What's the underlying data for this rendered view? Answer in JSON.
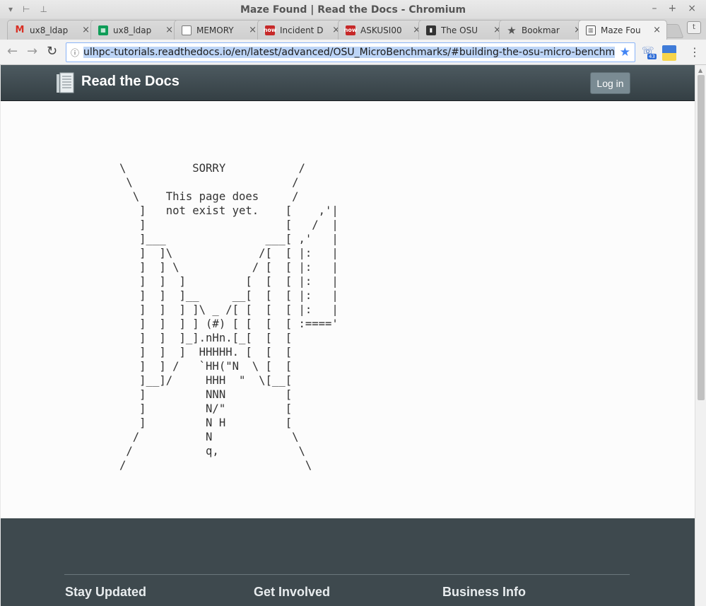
{
  "window": {
    "title": "Maze Found | Read the Docs - Chromium"
  },
  "tabs": [
    {
      "label": "ux8_ldap",
      "icon": "gmail-icon",
      "color": "#d93025"
    },
    {
      "label": "ux8_ldap",
      "icon": "sheets-icon",
      "color": "#0f9d58"
    },
    {
      "label": "MEMORY",
      "icon": "document-icon",
      "color": "#777777"
    },
    {
      "label": "Incident D",
      "icon": "servicenow-icon",
      "color": "#c62828"
    },
    {
      "label": "ASKUSI00",
      "icon": "servicenow-icon",
      "color": "#c62828"
    },
    {
      "label": "The OSU",
      "icon": "book-icon",
      "color": "#333333"
    },
    {
      "label": "Bookmar",
      "icon": "star-icon",
      "color": "#555555"
    },
    {
      "label": "Maze Fou",
      "icon": "readthedocs-icon",
      "color": "#555555",
      "active": true
    }
  ],
  "toolbar": {
    "url": "ulhpc-tutorials.readthedocs.io/en/latest/advanced/OSU_MicroBenchmarks/#building-the-osu-micro-benchmark",
    "extension_badge": "43",
    "ext_t": "t"
  },
  "site": {
    "brand": "Read the Docs",
    "login_label": "Log in"
  },
  "ascii_art": "\\          SORRY           /\n \\                        /\n  \\    This page does     /\n   ]   not exist yet.    [    ,'|\n   ]                     [   /  |\n   ]___               ___[ ,'   |\n   ]  ]\\             /[  [ |:   |\n   ]  ] \\           / [  [ |:   |\n   ]  ]  ]         [  [  [ |:   |\n   ]  ]  ]__     __[  [  [ |:   |\n   ]  ]  ] ]\\ _ /[ [  [  [ |:   |\n   ]  ]  ] ] (#) [ [  [  [ :===='\n   ]  ]  ]_].nHn.[_[  [  [\n   ]  ]  ]  HHHHH. [  [  [\n   ]  ] /   `HH(\"N  \\ [  [\n   ]__]/     HHH  \"  \\[__[\n   ]         NNN         [\n   ]         N/\"         [\n   ]         N H         [\n  /          N            \\\n /           q,            \\\n/                           \\",
  "footer": {
    "headings": [
      "Stay Updated",
      "Get Involved",
      "Business Info"
    ]
  }
}
